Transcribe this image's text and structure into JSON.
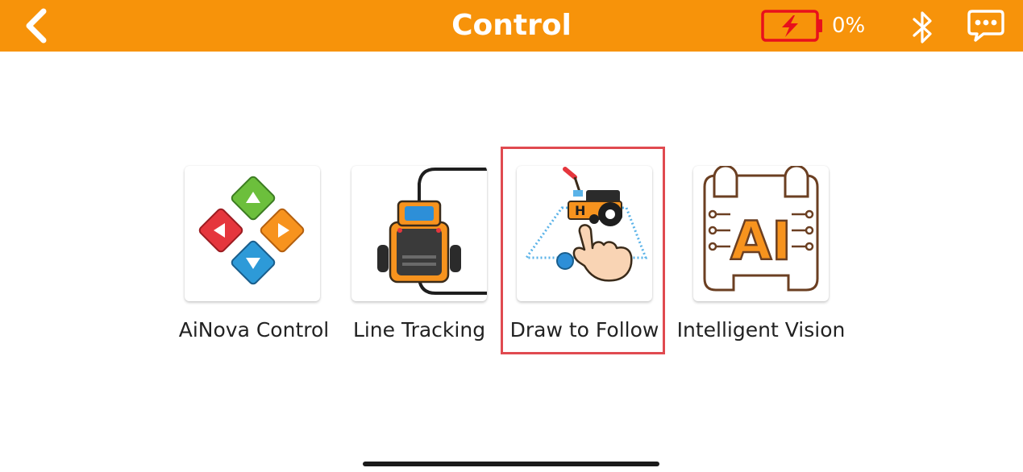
{
  "header": {
    "title": "Control",
    "battery_percent": "0%",
    "back_icon": "chevron-left-icon",
    "battery_icon": "battery-charging-icon",
    "bluetooth_icon": "bluetooth-icon",
    "message_icon": "chat-bubble-icon",
    "bar_color": "#f7930a",
    "battery_color": "#e8101c"
  },
  "modes": [
    {
      "label": "AiNova Control",
      "icon": "direction-pad-icon"
    },
    {
      "label": "Line Tracking",
      "icon": "line-tracking-robot-icon"
    },
    {
      "label": "Draw to Follow",
      "icon": "draw-to-follow-icon",
      "selected": true
    },
    {
      "label": "Intelligent Vision",
      "icon": "ai-chip-icon"
    }
  ]
}
